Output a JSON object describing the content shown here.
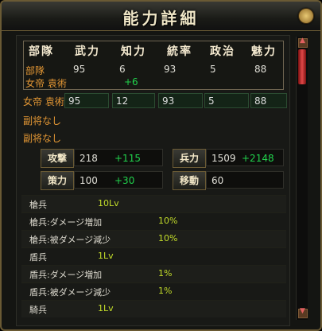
{
  "window": {
    "title": "能力詳細"
  },
  "header": {
    "cols": [
      "部隊",
      "武力",
      "知力",
      "統率",
      "政治",
      "魅力"
    ]
  },
  "unit": {
    "label": "部隊",
    "officer": "女帝 袁術",
    "values": [
      "95",
      "6",
      "93",
      "5",
      "88"
    ],
    "bonus": "+6"
  },
  "rows": [
    {
      "name": "女帝 袁術",
      "values": [
        "95",
        "12",
        "93",
        "5",
        "88"
      ]
    },
    {
      "name": "副将なし"
    },
    {
      "name": "副将なし"
    }
  ],
  "stats": {
    "attack": {
      "label": "攻撃",
      "value": "218",
      "bonus": "+115"
    },
    "troops": {
      "label": "兵力",
      "value": "1509",
      "bonus": "+2148"
    },
    "tactics": {
      "label": "策力",
      "value": "100",
      "bonus": "+30"
    },
    "move": {
      "label": "移動",
      "value": "60"
    }
  },
  "skills": [
    {
      "name": "槍兵",
      "value": "10Lv"
    },
    {
      "name": "槍兵:ダメージ増加",
      "value": "10%"
    },
    {
      "name": "槍兵:被ダメージ減少",
      "value": "10%"
    },
    {
      "name": "盾兵",
      "value": "1Lv"
    },
    {
      "name": "盾兵:ダメージ増加",
      "value": "1%"
    },
    {
      "name": "盾兵:被ダメージ減少",
      "value": "1%"
    },
    {
      "name": "騎兵",
      "value": "1Lv"
    }
  ],
  "colors": {
    "accent": "#e29634",
    "bonus": "#21d24c",
    "skill_value": "#c3dd2a",
    "border": "#6a5a34"
  }
}
